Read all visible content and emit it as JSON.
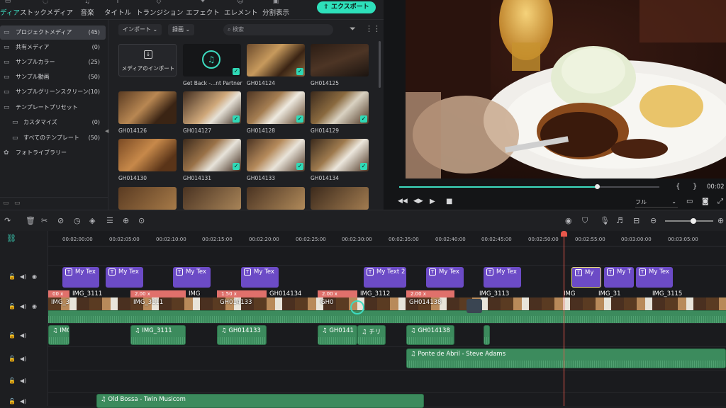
{
  "nav": {
    "tabs": [
      {
        "label": "ディア",
        "icon": "media-icon"
      },
      {
        "label": "ストックメディア",
        "icon": "stock-icon"
      },
      {
        "label": "音楽",
        "icon": "music-icon"
      },
      {
        "label": "タイトル",
        "icon": "title-icon"
      },
      {
        "label": "トランジション",
        "icon": "transition-icon"
      },
      {
        "label": "エフェクト",
        "icon": "effect-icon"
      },
      {
        "label": "エレメント",
        "icon": "element-icon"
      },
      {
        "label": "分割表示",
        "icon": "split-icon"
      }
    ],
    "export_label": "エクスポート"
  },
  "sidebar": {
    "items": [
      {
        "label": "プロジェクトメディア",
        "count": "(45)"
      },
      {
        "label": "共有メディア",
        "count": "(0)"
      },
      {
        "label": "サンプルカラー",
        "count": "(25)"
      },
      {
        "label": "サンプル動画",
        "count": "(50)"
      },
      {
        "label": "サンプルグリーンスクリーン",
        "count": "(10)"
      },
      {
        "label": "テンプレートプリセット",
        "count": ""
      },
      {
        "label": "カスタマイズ",
        "count": "(0)"
      },
      {
        "label": "すべてのテンプレート",
        "count": "(50)"
      },
      {
        "label": "フォトライブラリー",
        "count": ""
      }
    ]
  },
  "media": {
    "import_dropdown": "インポート",
    "record_dropdown": "録画",
    "search_placeholder": "検索",
    "import_tile_label": "メディアのインポート",
    "items": [
      {
        "name": "Get Back -...nt Partner"
      },
      {
        "name": "GH014124"
      },
      {
        "name": "GH014125"
      },
      {
        "name": "GH014126"
      },
      {
        "name": "GH014127"
      },
      {
        "name": "GH014128"
      },
      {
        "name": "GH014129"
      },
      {
        "name": "GH014130"
      },
      {
        "name": "GH014131"
      },
      {
        "name": "GH014133"
      },
      {
        "name": "GH014134"
      }
    ]
  },
  "preview": {
    "progress": 0.76,
    "brace_left": "{",
    "brace_right": "}",
    "timecode": "00:02",
    "quality": "フル"
  },
  "timeline": {
    "ruler": [
      "00:02:00:00",
      "00:02:05:00",
      "00:02:10:00",
      "00:02:15:00",
      "00:02:20:00",
      "00:02:25:00",
      "00:02:30:00",
      "00:02:35:00",
      "00:02:40:00",
      "00:02:45:00",
      "00:02:50:00",
      "00:02:55:00",
      "00:03:00:00",
      "00:03:05:00"
    ],
    "text_clips": [
      "My Tex",
      "My Tex",
      "My Tex",
      "My Tex",
      "My Text 2",
      "My Tex",
      "My Tex",
      "My",
      "My T",
      "My Tex"
    ],
    "speed_labels": [
      "00 x",
      "2.00 x",
      "1.50 x",
      "2.00 x",
      "2.00 x"
    ],
    "video_clips": [
      "IMG_3111",
      "IMG_3111",
      "IMG",
      "GH014133",
      "GH014134",
      "GH0",
      "IMG_3112",
      "GH014138",
      "IMG_3113",
      "IMG",
      "IMG_31",
      "IMG_3115"
    ],
    "audio_clips": [
      "IMG",
      "IMG_3111",
      "GH014133",
      "GH0141",
      "チリ",
      "GH014138"
    ],
    "music_1": "Ponte de Abril - Steve Adams",
    "music_2": "Old Bossa - Twin Musicom"
  }
}
